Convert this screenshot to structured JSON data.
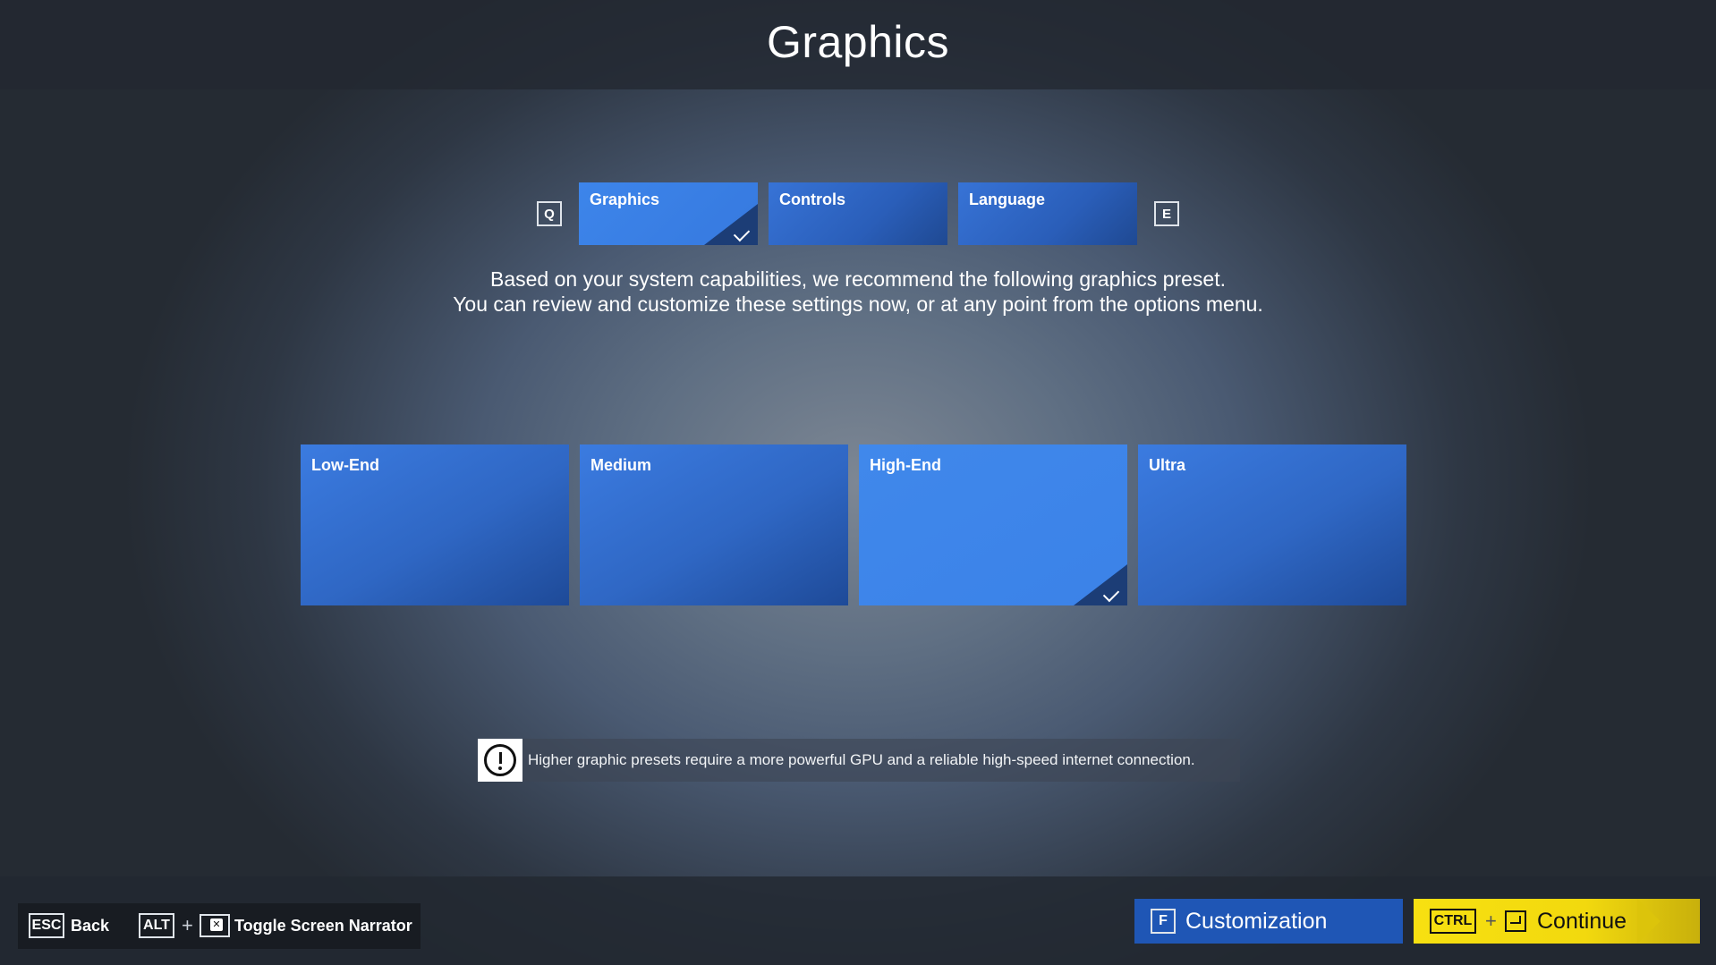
{
  "page_title": "Graphics",
  "tabs": {
    "prev_key": "Q",
    "next_key": "E",
    "items": [
      {
        "label": "Graphics",
        "active": true
      },
      {
        "label": "Controls",
        "active": false
      },
      {
        "label": "Language",
        "active": false
      }
    ]
  },
  "recommendation": {
    "line1": "Based on your system capabilities, we recommend the following graphics preset.",
    "line2": "You can review and customize these settings now, or at any point from the options menu."
  },
  "presets": [
    {
      "label": "Low-End",
      "selected": false
    },
    {
      "label": "Medium",
      "selected": false
    },
    {
      "label": "High-End",
      "selected": true
    },
    {
      "label": "Ultra",
      "selected": false
    }
  ],
  "warning": {
    "icon": "exclamation-circle-icon",
    "text": "Higher graphic presets require a more powerful GPU and a reliable high-speed internet connection."
  },
  "footer": {
    "back_key": "ESC",
    "back_label": "Back",
    "narrator_key": "ALT",
    "narrator_plus": "+",
    "narrator_label": "Toggle Screen Narrator",
    "customization_key": "F",
    "customization_label": "Customization",
    "continue_key": "CTRL",
    "continue_plus": "+",
    "continue_label": "Continue"
  },
  "colors": {
    "tile_blue": "#2f67c4",
    "tile_active_blue": "#3b82e8",
    "primary_button": "#1f56b5",
    "continue_yellow": "#f2d90e"
  }
}
